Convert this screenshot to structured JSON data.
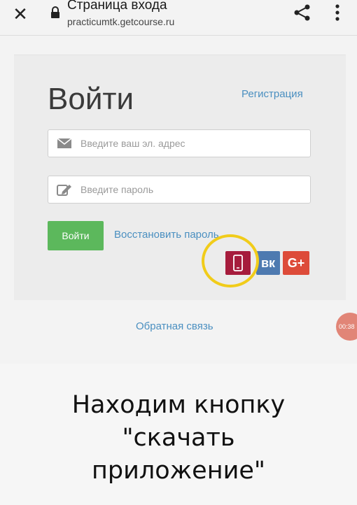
{
  "browser": {
    "page_title": "Страница входа",
    "url": "practicumtk.getcourse.ru",
    "close_icon": "close-icon",
    "lock_icon": "lock-icon",
    "share_icon": "share-icon",
    "menu_icon": "more-vert-icon"
  },
  "form": {
    "title": "Войти",
    "register_link": "Регистрация",
    "email_placeholder": "Введите ваш эл. адрес",
    "email_icon": "envelope-icon",
    "password_placeholder": "Введите пароль",
    "password_icon": "edit-icon",
    "login_button": "Войти",
    "restore_link": "Восстановить пароль",
    "social": {
      "app_icon": "mobile-phone-icon",
      "vk_label": "вк",
      "gplus_label": "G+"
    },
    "accent_color": "#5cb85c",
    "highlight_color": "#f1cc1a"
  },
  "feedback_link": "Обратная связь",
  "timer": "00:38",
  "caption": {
    "line1": "Находим кнопку",
    "line2": "\"скачать",
    "line3": "приложение\""
  }
}
